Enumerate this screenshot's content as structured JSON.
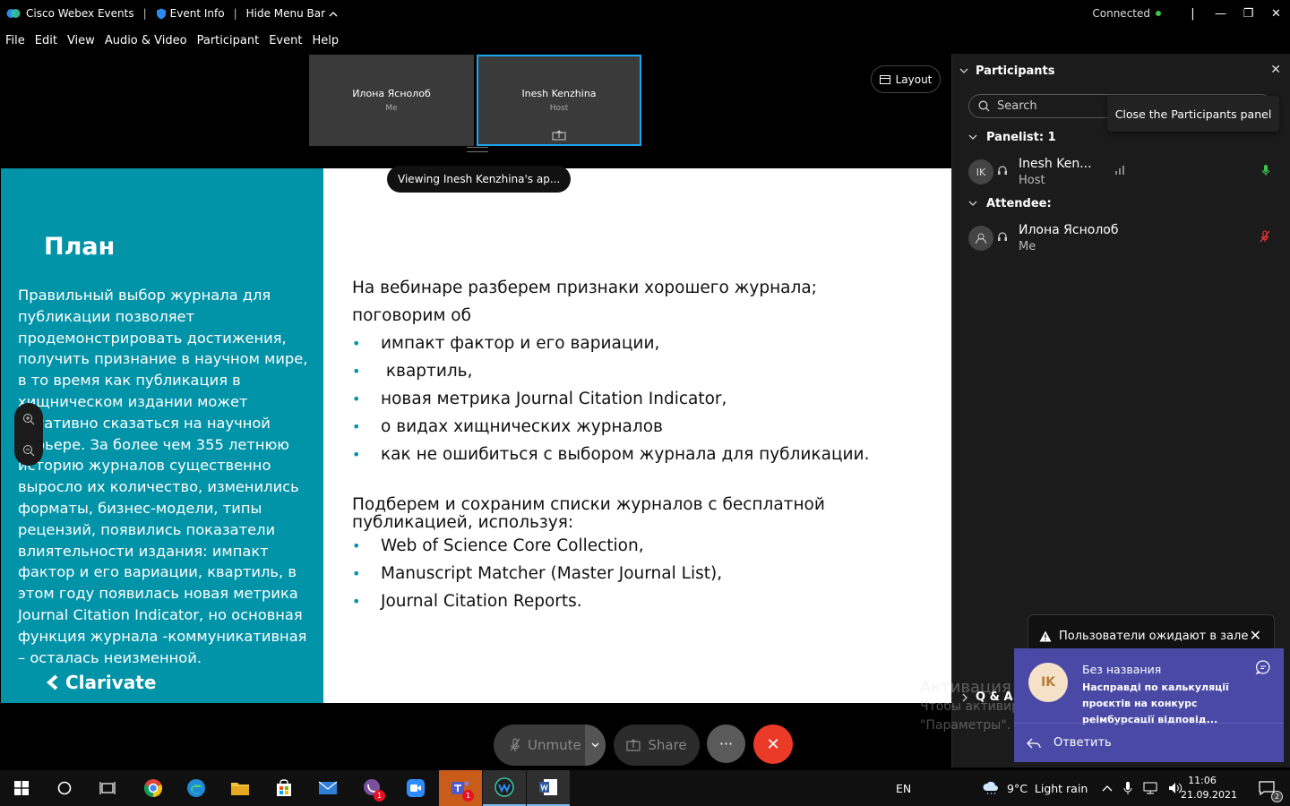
{
  "titlebar": {
    "app_name": "Cisco Webex Events",
    "event_info": "Event Info",
    "hide_menu": "Hide Menu Bar",
    "status": "Connected"
  },
  "menu": [
    "File",
    "Edit",
    "View",
    "Audio & Video",
    "Participant",
    "Event",
    "Help"
  ],
  "tiles": [
    {
      "name": "Илона Яснолоб",
      "role": "Me"
    },
    {
      "name": "Inesh Kenzhina",
      "role": "Host"
    }
  ],
  "layout_label": "Layout",
  "viewing_label": "Viewing Inesh Kenzhina's ap...",
  "slide": {
    "title": "План",
    "paragraph": "Правильный выбор журнала для публикации позволяет продемонстрировать достижения, получить признание в научном мире, в то время как публикация в хищническом издании может негативно сказаться на научной карьере. За более чем 355 летнюю историю журналов существенно выросло их количество, изменились форматы, бизнес-модели, типы рецензий, появились показатели влиятельности издания: импакт фактор и его вариации, квартиль, в этом году появилась новая метрика Journal Citation Indicator, но основная функция журнала -коммуникативная – осталась неизменной.",
    "brand": "Clarivate",
    "intro_line1": "На вебинаре разберем признаки хорошего журнала;",
    "intro_line2": "поговорим об",
    "bullets1": [
      "импакт фактор и его вариации,",
      " квартиль,",
      "новая метрика Journal Citation Indicator,",
      "о видах хищнических журналов",
      "как не ошибиться с выбором журнала для публикации."
    ],
    "intro2": "Подберем и сохраним списки журналов с бесплатной публикацией, используя:",
    "bullets2": [
      "Web of Science Core Collection,",
      "Manuscript Matcher (Master Journal List),",
      "Journal Citation Reports."
    ]
  },
  "panel": {
    "title": "Participants",
    "search_placeholder": "Search",
    "tooltip": "Close the Participants panel",
    "panelists_label": "Panelist: 1",
    "attendees_label": "Attendee:",
    "panelist": {
      "initials": "IK",
      "name": "Inesh Ken...",
      "role": "Host"
    },
    "attendee": {
      "name": "Илона Яснолоб",
      "role": "Me"
    }
  },
  "lobby_notice": "Пользователи ожидают в зале",
  "toast": {
    "initials": "IK",
    "title": "Без названия",
    "body": "Насправді по калькуляції проєктів на конкурс реімбурсації відповід...",
    "reply": "Ответить"
  },
  "qa_label": "Q & A",
  "watermark": {
    "line1": "Активация Windows",
    "line2": "Чтобы активировать Windows, перейдите в раздел",
    "line3": "\"Параметры\"."
  },
  "controls": {
    "unmute": "Unmute",
    "share": "Share"
  },
  "taskbar": {
    "lang": "EN",
    "weather": "9°C  Light rain",
    "time": "11:06",
    "date": "21.09.2021",
    "viber_badge": "1",
    "teams_badge": "1",
    "notif_count": "2"
  },
  "colors": {
    "accent": "#1aa5ef",
    "slide_teal": "#0193a8",
    "end_red": "#ec3a28",
    "toast": "#4a4aa6"
  }
}
